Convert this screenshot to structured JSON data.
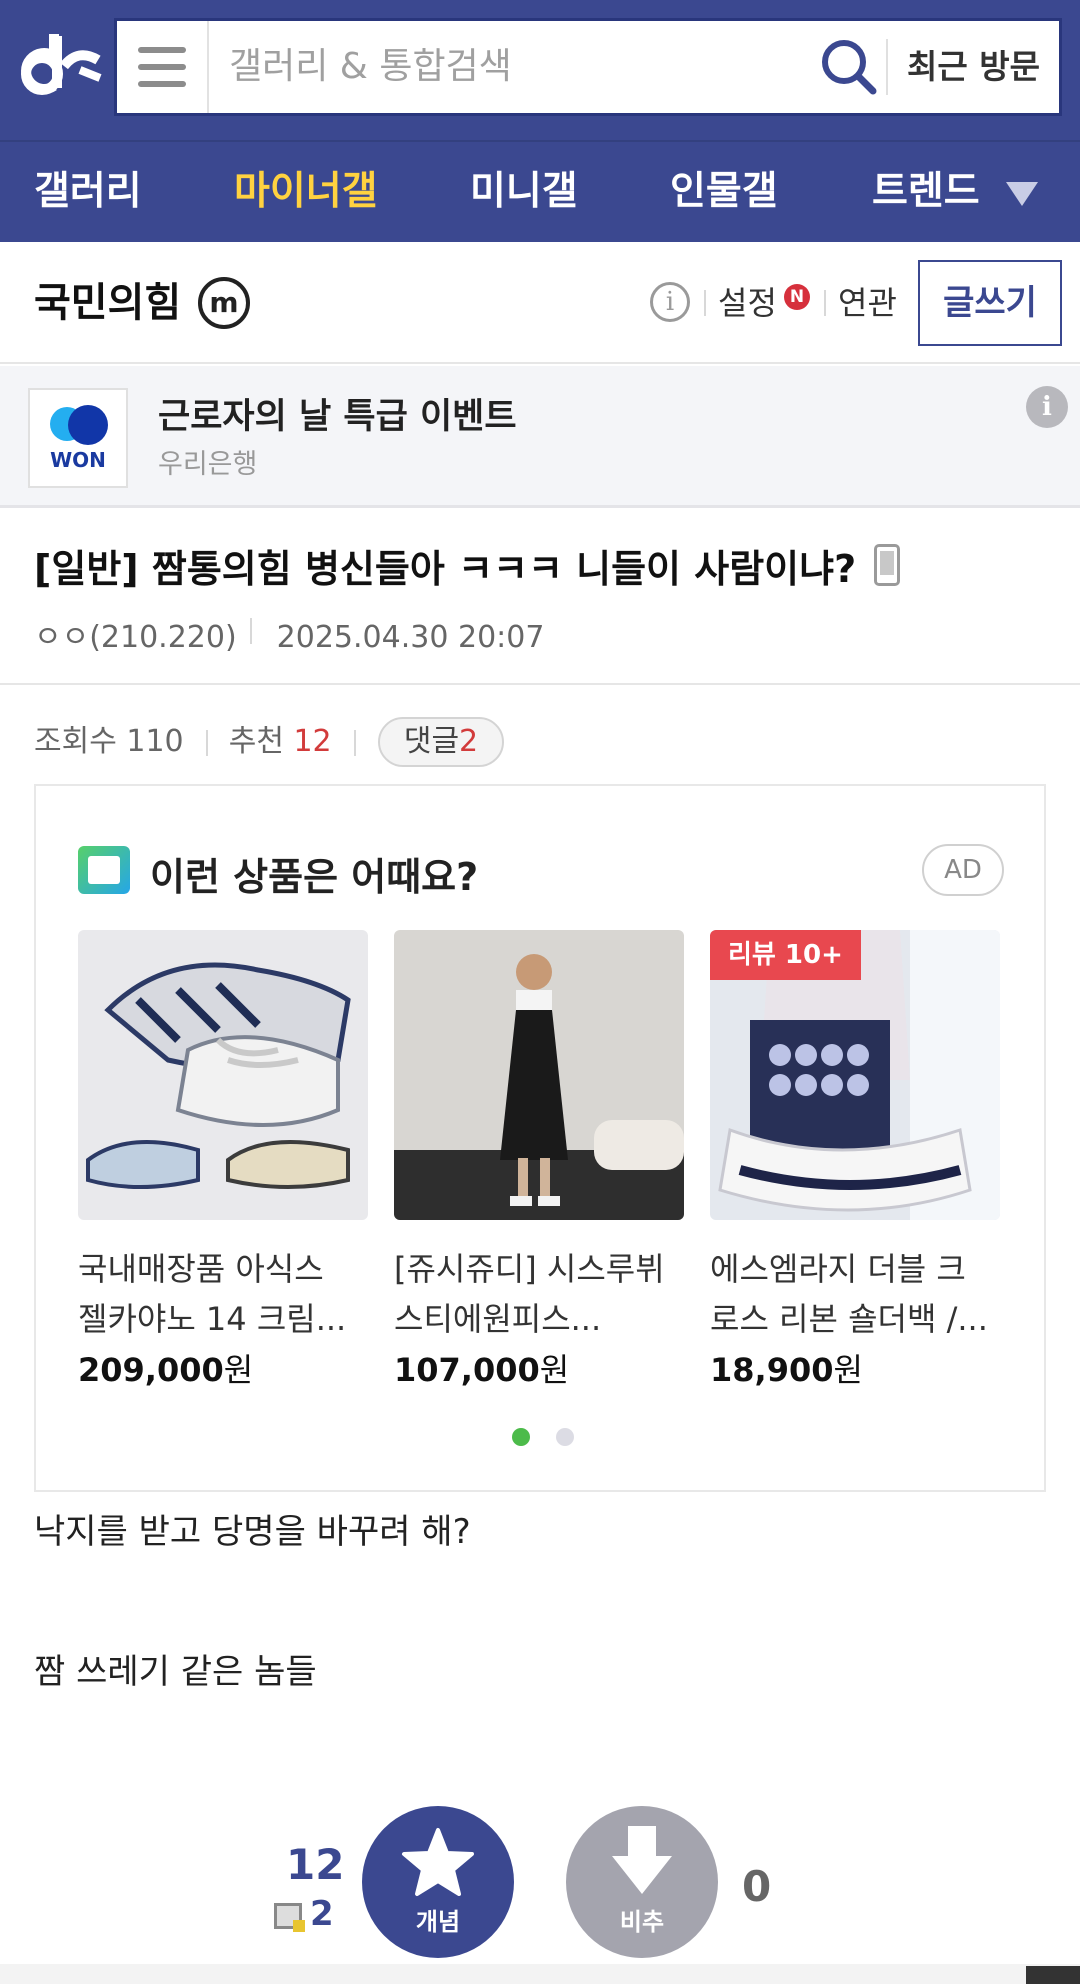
{
  "header": {
    "search_placeholder": "갤러리 & 통합검색",
    "recent_label": "최근 방문"
  },
  "nav": {
    "items": [
      "갤러리",
      "마이너갤",
      "미니갤",
      "인물갤",
      "트렌드"
    ],
    "active_index": 1
  },
  "gallery": {
    "title": "국민의힘",
    "badge": "m",
    "settings_label": "설정",
    "new_badge": "N",
    "related_label": "연관",
    "write_label": "글쓰기"
  },
  "banner": {
    "logo_text": "WON",
    "title": "근로자의 날 특급 이벤트",
    "subtitle": "우리은행",
    "info": "i"
  },
  "post": {
    "title": "[일반] 짬통의힘 병신들아 ㅋㅋㅋ 니들이 사람이냐?",
    "author": "ㅇㅇ(210.220)",
    "date": "2025.04.30 20:07",
    "views_label": "조회수",
    "views": "110",
    "recommend_label": "추천",
    "recommend": "12",
    "comment_label": "댓글",
    "comment_count": "2",
    "body_lines": [
      "낙지를 받고 당명을 바꾸려 해?",
      "짬 쓰레기 같은 놈들"
    ]
  },
  "ad": {
    "title": "이런 상품은 어때요?",
    "badge": "AD",
    "products": [
      {
        "name_line1": "국내매장품 아식스",
        "name_line2": "젤카야노 14 크림...",
        "price": "209,000",
        "currency": "원",
        "tag": ""
      },
      {
        "name_line1": "[쥬시쥬디] 시스루뷔",
        "name_line2": "스티에원피스...",
        "price": "107,000",
        "currency": "원",
        "tag": ""
      },
      {
        "name_line1": "에스엠라지 더블 크",
        "name_line2": "로스 리본 숄더백 /...",
        "price": "18,900",
        "currency": "원",
        "tag": "리뷰 10+"
      }
    ],
    "active_page": 1,
    "page_count": 2
  },
  "vote": {
    "up_count": "12",
    "up_fixed": "2",
    "up_label": "개념",
    "down_label": "비추",
    "down_count": "0"
  },
  "colors": {
    "brand": "#3b4890",
    "active_nav": "#ffd240",
    "accent_red": "#d23b3b"
  },
  "icons": [
    "dc-logo-icon",
    "menu-icon",
    "search-icon",
    "info-icon",
    "phone-icon",
    "star-icon",
    "arrow-down-icon"
  ]
}
